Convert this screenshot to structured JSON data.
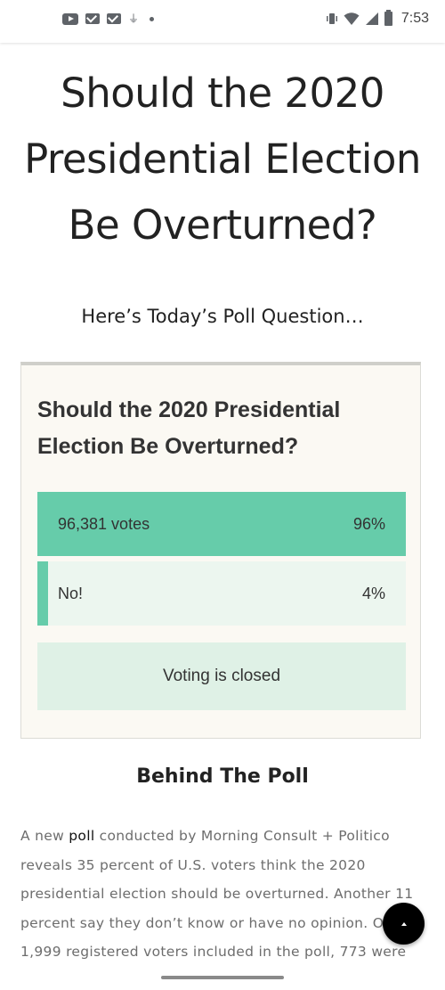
{
  "status_bar": {
    "time": "7:53",
    "left_icons": [
      "youtube-icon",
      "mail-icon",
      "mail-icon",
      "usb-icon",
      "dot-icon"
    ],
    "right_icons": [
      "vibrate-icon",
      "wifi-icon",
      "cellular-icon",
      "battery-icon"
    ]
  },
  "page": {
    "title": "Should the 2020 Presidential Election Be Overturned?",
    "subtitle": "Here’s Today’s Poll Question…"
  },
  "poll": {
    "question": "Should the 2020 Presidential Election Be Overturned?",
    "options": [
      {
        "label": "96,381 votes",
        "percent_text": "96%",
        "fill_fraction": 1.0
      },
      {
        "label": "No!",
        "percent_text": "4%",
        "fill_fraction": 0.03
      }
    ],
    "status": "Voting is closed",
    "colors": {
      "fill": "#66ccaa",
      "track": "#ecf6ef",
      "closed_bg": "#dff1e6",
      "card_bg": "#fbf9f3"
    }
  },
  "article": {
    "section_heading": "Behind The Poll",
    "body_before_link": "A new ",
    "link_text": "poll",
    "body_after_link": " conducted by Morning Consult + Politico reveals 35 percent of U.S. voters think the 2020 presidential election should be overturned. Another 11 percent say they don’t know or have no opinion. Of 1,999 registered voters included in the poll, 773 were"
  },
  "scroll_top_button": {
    "icon": "chevron-up-icon"
  }
}
